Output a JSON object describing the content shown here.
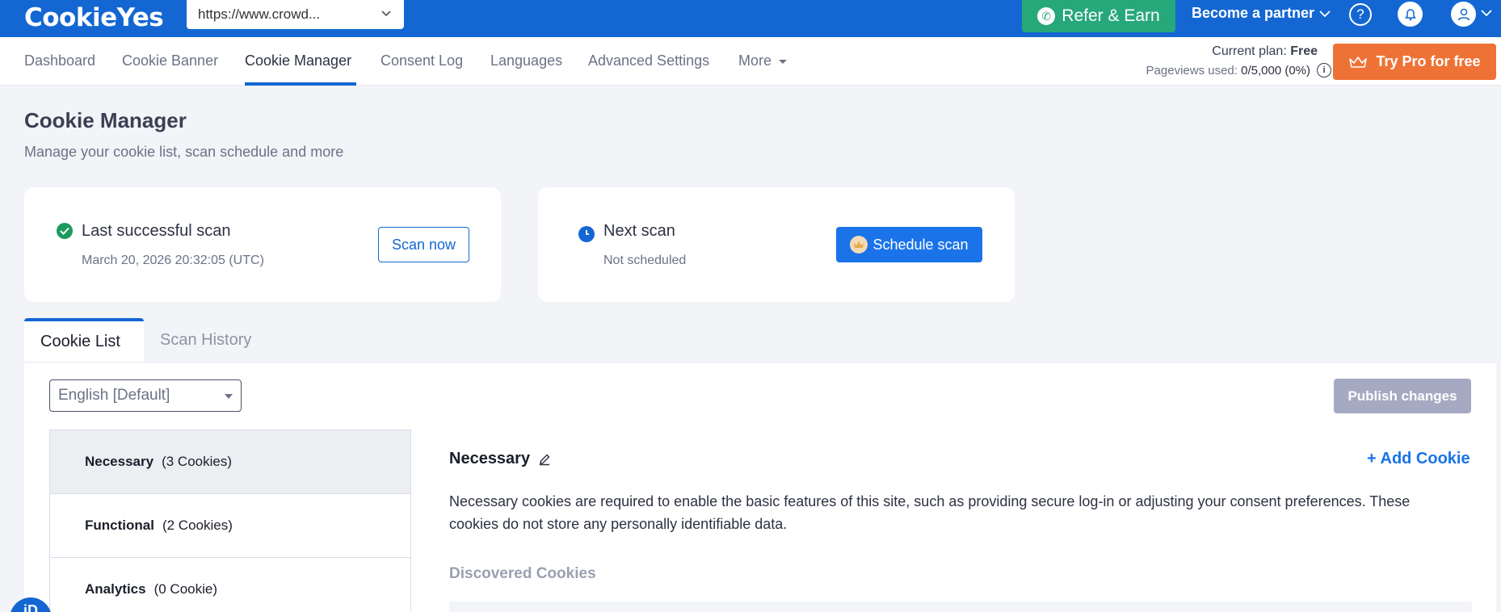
{
  "app": {
    "logo": "CookieYes"
  },
  "topbar": {
    "site_url": "https://www.crowd...",
    "refer_label": "Refer & Earn",
    "partner_label": "Become a partner",
    "help_icon": "question-circle-icon",
    "bell_icon": "bell-icon",
    "user_icon": "user-icon",
    "brand_color": "#1467d2",
    "refer_color": "#27a87b"
  },
  "nav": {
    "items": [
      "Dashboard",
      "Cookie Banner",
      "Cookie Manager",
      "Consent Log",
      "Languages",
      "Advanced Settings",
      "More"
    ],
    "active": "Cookie Manager"
  },
  "plan": {
    "label": "Current plan: ",
    "value": "Free",
    "pageviews_label": "Pageviews used: ",
    "pageviews_value": "0/5,000 (0%)",
    "try_pro_label": "Try Pro for free",
    "try_pro_color": "#ee7235"
  },
  "page": {
    "title": "Cookie Manager",
    "subtitle": "Manage your cookie list, scan schedule and more"
  },
  "scan_cards": {
    "last": {
      "title": "Last successful scan",
      "date": "March 20, 2026 20:32:05 (UTC)",
      "button": "Scan now"
    },
    "next": {
      "title": "Next scan",
      "status": "Not scheduled",
      "button": "Schedule scan"
    }
  },
  "tabs": [
    "Cookie List",
    "Scan History"
  ],
  "cookie_list": {
    "language": "English [Default]",
    "publish_label": "Publish changes",
    "categories": [
      {
        "name": "Necessary",
        "count": "(3 Cookies)"
      },
      {
        "name": "Functional",
        "count": "(2 Cookies)"
      },
      {
        "name": "Analytics",
        "count": "(0 Cookie)"
      }
    ],
    "detail": {
      "title": "Necessary",
      "add_label": "+ Add Cookie",
      "description": "Necessary cookies are required to enable the basic features of this site, such as providing secure log-in or adjusting your consent preferences. These cookies do not store any personally identifiable data.",
      "discovered_label": "Discovered Cookies"
    }
  }
}
